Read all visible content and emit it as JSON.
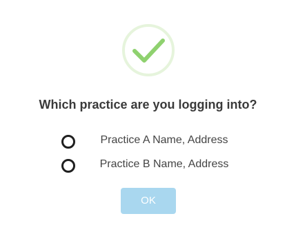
{
  "dialog": {
    "icon": "checkmark-success-icon",
    "icon_color": "#8fd16f",
    "icon_ring_color": "#e6f4dc",
    "title": "Which practice are you logging into?",
    "options": [
      {
        "label": "Practice A Name, Address",
        "selected": false
      },
      {
        "label": "Practice B Name, Address",
        "selected": false
      }
    ],
    "ok_label": "OK",
    "ok_button_color": "#a9d7ef"
  }
}
